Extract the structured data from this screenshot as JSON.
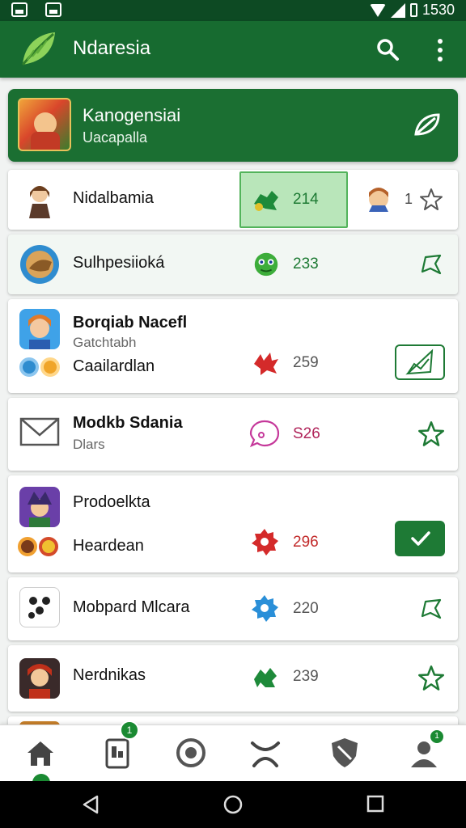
{
  "status_bar": {
    "time": "1530"
  },
  "app_bar": {
    "title": "Ndaresia"
  },
  "featured": {
    "title": "Kanogensiai",
    "subtitle": "Uacapalla"
  },
  "rows": [
    {
      "label": "Nidalbamia",
      "count": "214",
      "extra_count": "1"
    },
    {
      "label": "Sulhpesiioká",
      "count": "233"
    },
    {
      "title": "Borqiab Nacefl",
      "subtitle": "Gatchtabh",
      "label": "Caailardlan",
      "count": "259"
    },
    {
      "label": "Modkb Sdania",
      "subtitle": "Dlars",
      "count": "S26"
    },
    {
      "title": "Prodoelkta",
      "label": "Heardean",
      "count": "296"
    },
    {
      "label": "Mobpard Mlcara",
      "count": "220"
    },
    {
      "label": "Nerdnikas",
      "count": "239"
    }
  ],
  "bottom_nav": {
    "items": [
      "home-icon",
      "phone-icon",
      "target-icon",
      "cup-icon",
      "shield-icon",
      "profile-icon"
    ],
    "badges": {
      "phone": "1",
      "profile": "1"
    }
  },
  "colors": {
    "primary": "#176b30",
    "accent": "#1e7a35",
    "highlight": "#b9e6ba"
  }
}
